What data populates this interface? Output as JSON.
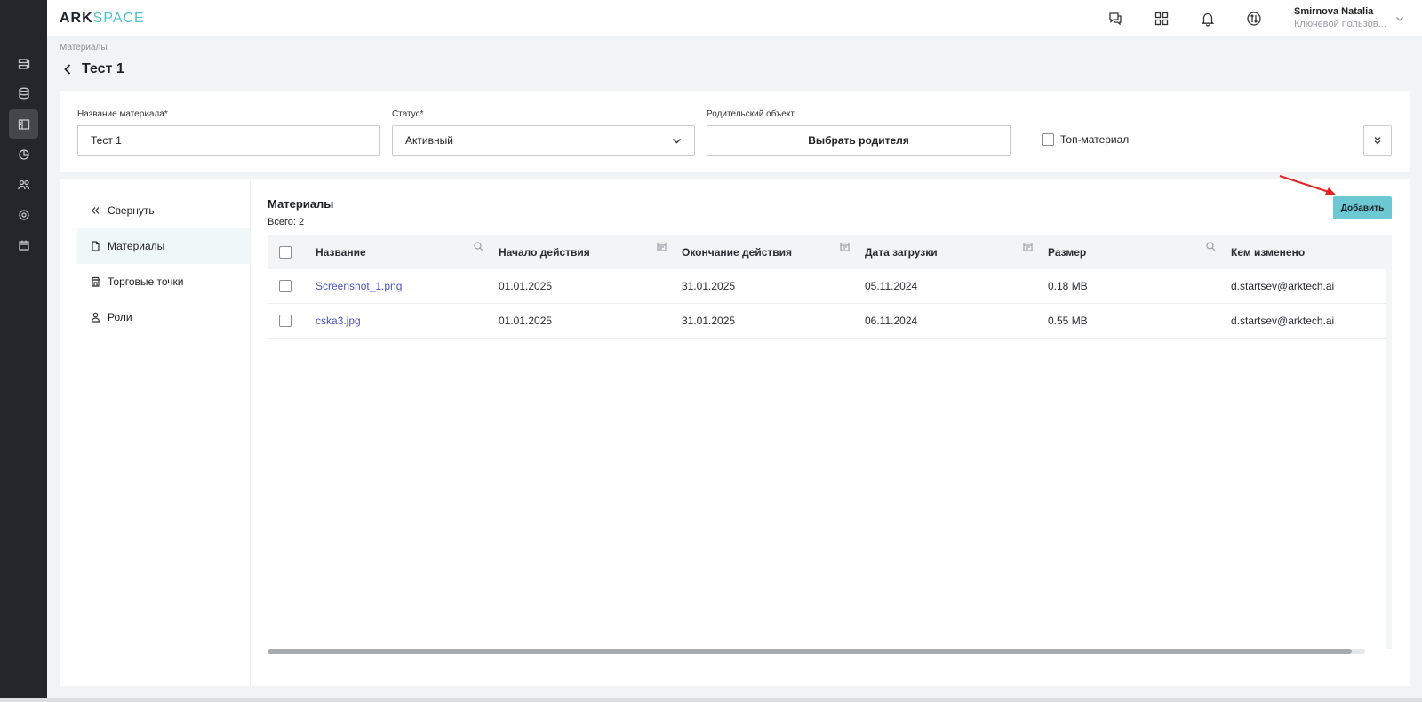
{
  "app": {
    "logo_part1": "ARK",
    "logo_part2": "SPACE",
    "brand_color": "#4fc1d3"
  },
  "rail": {
    "items": [
      {
        "icon": "server-list-icon"
      },
      {
        "icon": "database-icon"
      },
      {
        "icon": "catalog-icon",
        "active": true
      },
      {
        "icon": "pie-chart-icon"
      },
      {
        "icon": "users-icon"
      },
      {
        "icon": "settings-icon"
      },
      {
        "icon": "calendar-icon"
      }
    ]
  },
  "topbar": {
    "icons": [
      "help-chat-icon",
      "apps-grid-icon",
      "bell-icon",
      "sync-icon"
    ],
    "user_name": "Smirnova Natalia",
    "user_role": "Ключевой пользов..."
  },
  "page": {
    "breadcrumb": "Материалы",
    "title": "Тест 1"
  },
  "form": {
    "name_label": "Название материала*",
    "name_value": "Тест 1",
    "status_label": "Статус*",
    "status_value": "Активный",
    "parent_label": "Родительский объект",
    "parent_button": "Выбрать родителя",
    "top_material_label": "Топ-материал",
    "top_material_checked": false
  },
  "sidebar": {
    "items": [
      {
        "label": "Свернуть",
        "icon": "double-chevron-left-icon"
      },
      {
        "label": "Материалы",
        "icon": "document-icon",
        "active": true
      },
      {
        "label": "Торговые точки",
        "icon": "store-icon"
      },
      {
        "label": "Роли",
        "icon": "user-icon"
      }
    ]
  },
  "materials": {
    "title": "Материалы",
    "total": "Всего: 2",
    "add_button": "Добавить",
    "columns": [
      "Название",
      "Начало действия",
      "Окончание действия",
      "Дата загрузки",
      "Размер",
      "Кем изменено"
    ],
    "column_icons": [
      "search-icon",
      "calendar-filter-icon",
      "calendar-filter-icon",
      "calendar-filter-icon",
      "search-icon",
      ""
    ],
    "rows": [
      {
        "name": "Screenshot_1.png",
        "start": "01.01.2025",
        "end": "31.01.2025",
        "uploaded": "05.11.2024",
        "size": "0.18 MB",
        "changed_by": "d.startsev@arktech.ai"
      },
      {
        "name": "cska3.jpg",
        "start": "01.01.2025",
        "end": "31.01.2025",
        "uploaded": "06.11.2024",
        "size": "0.55 MB",
        "changed_by": "d.startsev@arktech.ai"
      }
    ]
  }
}
